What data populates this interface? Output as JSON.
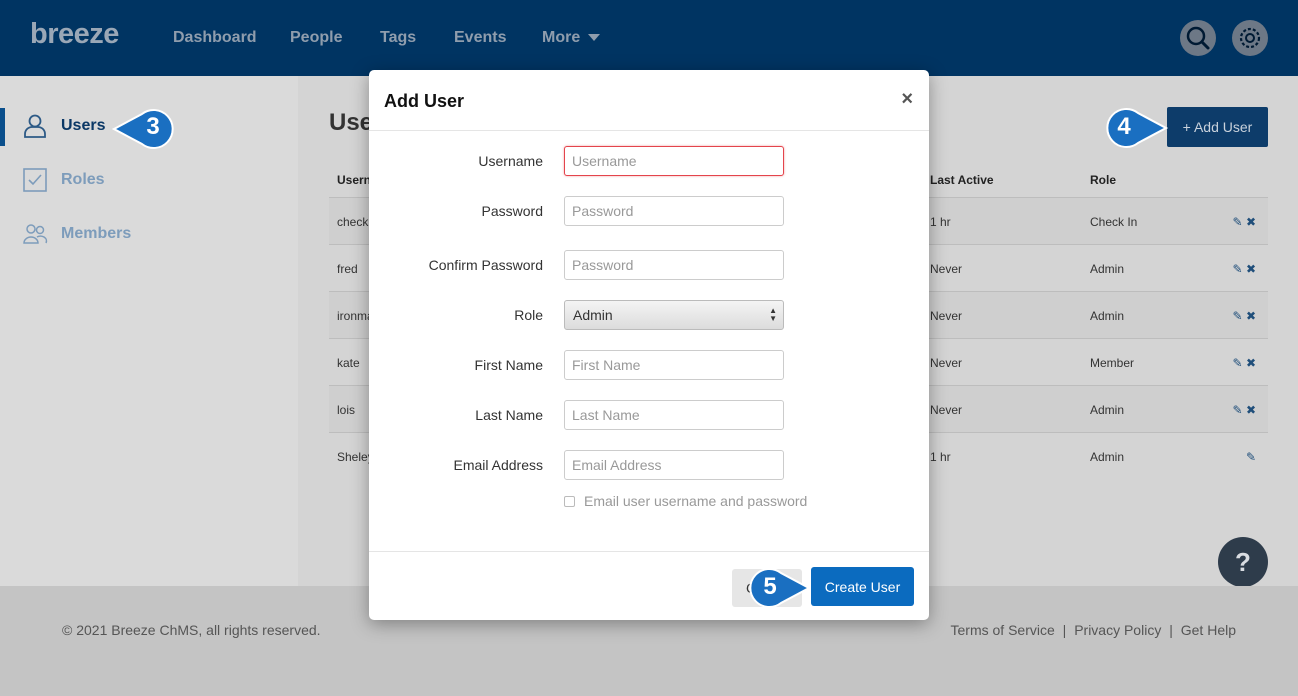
{
  "topnav": {
    "logo": "breeze",
    "items": [
      "Dashboard",
      "People",
      "Tags",
      "Events",
      "More"
    ]
  },
  "sidebar": {
    "items": [
      {
        "label": "Users",
        "icon": "user-icon"
      },
      {
        "label": "Roles",
        "icon": "checkbox-icon"
      },
      {
        "label": "Members",
        "icon": "group-icon"
      }
    ]
  },
  "main": {
    "title": "Use",
    "add_user_label": "+ Add User",
    "columns": [
      "Userna",
      "Last Active",
      "Role"
    ],
    "rows": [
      {
        "username": "check",
        "last_active": "1 hr",
        "role": "Check In",
        "deletable": true
      },
      {
        "username": "fred",
        "last_active": "Never",
        "role": "Admin",
        "deletable": true
      },
      {
        "username": "ironma",
        "last_active": "Never",
        "role": "Admin",
        "deletable": true
      },
      {
        "username": "kate",
        "last_active": "Never",
        "role": "Member",
        "deletable": true
      },
      {
        "username": "lois",
        "last_active": "Never",
        "role": "Admin",
        "deletable": true
      },
      {
        "username": "Sheley",
        "last_active": "1 hr",
        "role": "Admin",
        "deletable": false
      }
    ]
  },
  "help": {
    "label": "?"
  },
  "footer": {
    "copyright": "© 2021 Breeze ChMS, all rights reserved.",
    "links": [
      "Terms of Service",
      "Privacy Policy",
      "Get Help"
    ],
    "separator": "|"
  },
  "modal": {
    "title": "Add User",
    "close": "×",
    "fields": {
      "username": {
        "label": "Username",
        "placeholder": "Username"
      },
      "password": {
        "label": "Password",
        "placeholder": "Password"
      },
      "confirm_password": {
        "label": "Confirm Password",
        "placeholder": "Password"
      },
      "role": {
        "label": "Role",
        "value": "Admin"
      },
      "first_name": {
        "label": "First Name",
        "placeholder": "First Name"
      },
      "last_name": {
        "label": "Last Name",
        "placeholder": "Last Name"
      },
      "email": {
        "label": "Email Address",
        "placeholder": "Email Address"
      }
    },
    "checkbox_label": "Email user username and password",
    "cancel_label": "C",
    "create_label": "Create User"
  },
  "callouts": [
    "3",
    "4",
    "5"
  ],
  "colors": {
    "nav": "#003462",
    "primary_button": "#0b6bbf",
    "callout": "#1a6fc1"
  }
}
